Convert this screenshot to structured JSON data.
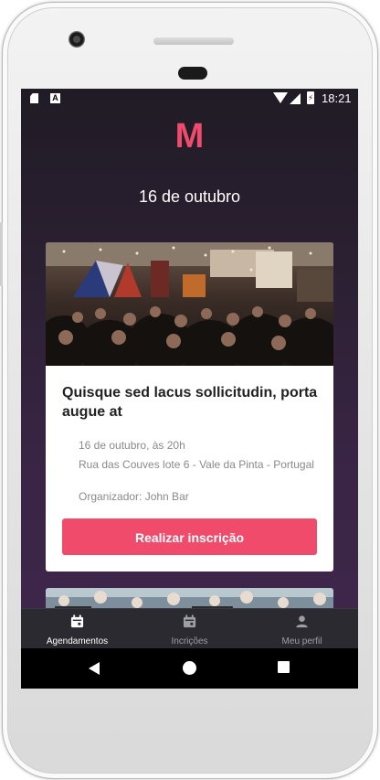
{
  "status_bar": {
    "time": "18:21",
    "a_label": "A"
  },
  "app": {
    "logo": "M",
    "date_heading": "16 de outubro"
  },
  "event": {
    "title": "Quisque sed lacus sollicitudin, porta augue at",
    "datetime": "16 de outubro, às 20h",
    "address": "Rua das Couves lote 6 - Vale da Pinta - Portugal",
    "organizer": "Organizador: John Bar",
    "cta_label": "Realizar inscrição"
  },
  "tabs": [
    {
      "label": "Agendamentos",
      "icon": "calendar-icon",
      "active": true
    },
    {
      "label": "Incrições",
      "icon": "calendar-icon",
      "active": false
    },
    {
      "label": "Meu perfil",
      "icon": "person-icon",
      "active": false
    }
  ],
  "colors": {
    "accent": "#f04b6b",
    "logo": "#ef4b6c",
    "background_top": "#201b25",
    "background_bottom": "#40274c",
    "tabbar": "#2a2a30"
  }
}
